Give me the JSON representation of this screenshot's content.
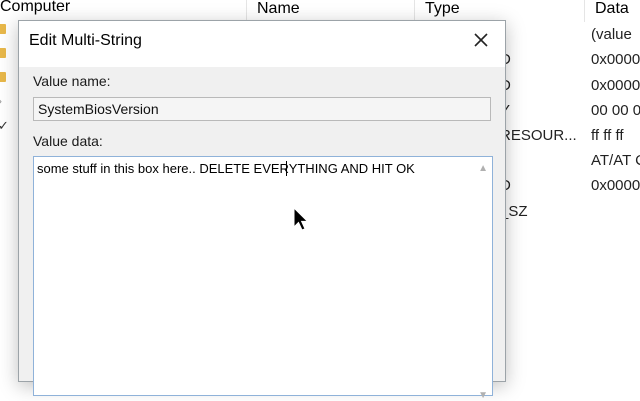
{
  "background": {
    "tree_title": "Computer",
    "columns": {
      "name": "Name",
      "type": "Type",
      "data": "Data"
    },
    "rows": [
      {
        "type": "",
        "data": "(value"
      },
      {
        "type": "D",
        "data": "0x0000"
      },
      {
        "type": "D",
        "data": "0x0000"
      },
      {
        "type": "Y",
        "data": "00 00 0"
      },
      {
        "type": "RESOUR...",
        "data": "ff ff ff"
      },
      {
        "type": "",
        "data": "AT/AT C"
      },
      {
        "type": "D",
        "data": "0x0000"
      },
      {
        "type": "_SZ",
        "data": ""
      }
    ]
  },
  "dialog": {
    "title": "Edit Multi-String",
    "value_name_label": "Value name:",
    "value_name": "SystemBiosVersion",
    "value_data_label": "Value data:",
    "value_data": "some stuff in this box here.. DELETE EVERYTHING AND HIT OK"
  },
  "icons": {
    "close": "close-icon",
    "scroll_up": "scroll-up-icon",
    "scroll_down": "scroll-down-icon",
    "cursor": "mouse-pointer-icon"
  }
}
